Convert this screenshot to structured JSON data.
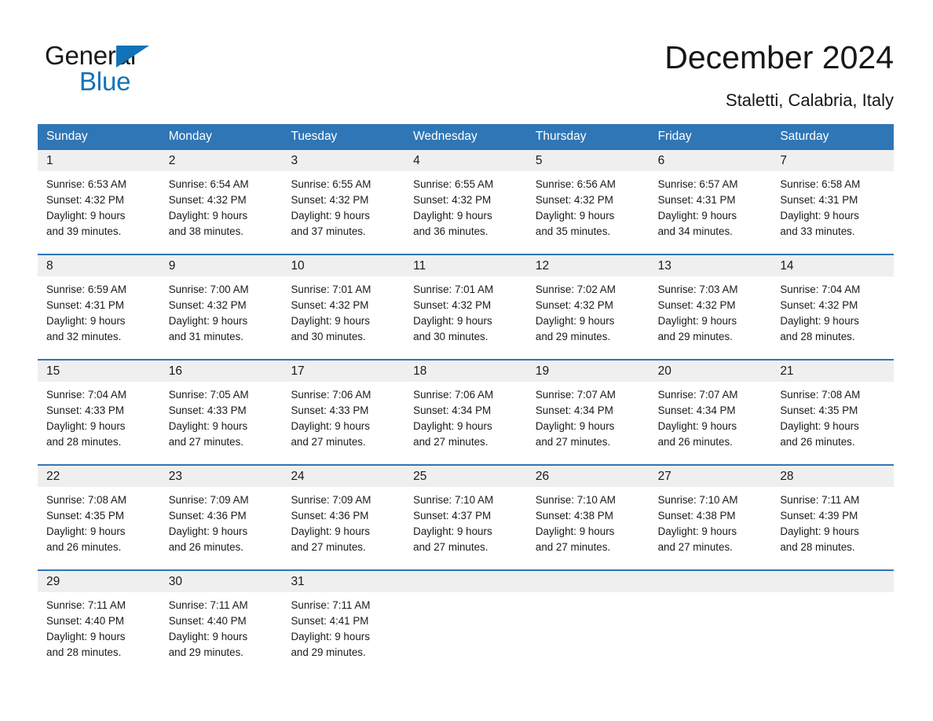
{
  "brand": {
    "name_part1": "General",
    "name_part2": "Blue",
    "triangle_color": "#1273b8"
  },
  "header": {
    "title": "December 2024",
    "subtitle": "Staletti, Calabria, Italy"
  },
  "colors": {
    "header_blue": "#2f76b6",
    "daynum_gray": "#efefef",
    "text": "#1a1a1a"
  },
  "weekdays": [
    "Sunday",
    "Monday",
    "Tuesday",
    "Wednesday",
    "Thursday",
    "Friday",
    "Saturday"
  ],
  "weeks": [
    [
      {
        "day": "1",
        "sunrise": "Sunrise: 6:53 AM",
        "sunset": "Sunset: 4:32 PM",
        "daylight1": "Daylight: 9 hours",
        "daylight2": "and 39 minutes."
      },
      {
        "day": "2",
        "sunrise": "Sunrise: 6:54 AM",
        "sunset": "Sunset: 4:32 PM",
        "daylight1": "Daylight: 9 hours",
        "daylight2": "and 38 minutes."
      },
      {
        "day": "3",
        "sunrise": "Sunrise: 6:55 AM",
        "sunset": "Sunset: 4:32 PM",
        "daylight1": "Daylight: 9 hours",
        "daylight2": "and 37 minutes."
      },
      {
        "day": "4",
        "sunrise": "Sunrise: 6:55 AM",
        "sunset": "Sunset: 4:32 PM",
        "daylight1": "Daylight: 9 hours",
        "daylight2": "and 36 minutes."
      },
      {
        "day": "5",
        "sunrise": "Sunrise: 6:56 AM",
        "sunset": "Sunset: 4:32 PM",
        "daylight1": "Daylight: 9 hours",
        "daylight2": "and 35 minutes."
      },
      {
        "day": "6",
        "sunrise": "Sunrise: 6:57 AM",
        "sunset": "Sunset: 4:31 PM",
        "daylight1": "Daylight: 9 hours",
        "daylight2": "and 34 minutes."
      },
      {
        "day": "7",
        "sunrise": "Sunrise: 6:58 AM",
        "sunset": "Sunset: 4:31 PM",
        "daylight1": "Daylight: 9 hours",
        "daylight2": "and 33 minutes."
      }
    ],
    [
      {
        "day": "8",
        "sunrise": "Sunrise: 6:59 AM",
        "sunset": "Sunset: 4:31 PM",
        "daylight1": "Daylight: 9 hours",
        "daylight2": "and 32 minutes."
      },
      {
        "day": "9",
        "sunrise": "Sunrise: 7:00 AM",
        "sunset": "Sunset: 4:32 PM",
        "daylight1": "Daylight: 9 hours",
        "daylight2": "and 31 minutes."
      },
      {
        "day": "10",
        "sunrise": "Sunrise: 7:01 AM",
        "sunset": "Sunset: 4:32 PM",
        "daylight1": "Daylight: 9 hours",
        "daylight2": "and 30 minutes."
      },
      {
        "day": "11",
        "sunrise": "Sunrise: 7:01 AM",
        "sunset": "Sunset: 4:32 PM",
        "daylight1": "Daylight: 9 hours",
        "daylight2": "and 30 minutes."
      },
      {
        "day": "12",
        "sunrise": "Sunrise: 7:02 AM",
        "sunset": "Sunset: 4:32 PM",
        "daylight1": "Daylight: 9 hours",
        "daylight2": "and 29 minutes."
      },
      {
        "day": "13",
        "sunrise": "Sunrise: 7:03 AM",
        "sunset": "Sunset: 4:32 PM",
        "daylight1": "Daylight: 9 hours",
        "daylight2": "and 29 minutes."
      },
      {
        "day": "14",
        "sunrise": "Sunrise: 7:04 AM",
        "sunset": "Sunset: 4:32 PM",
        "daylight1": "Daylight: 9 hours",
        "daylight2": "and 28 minutes."
      }
    ],
    [
      {
        "day": "15",
        "sunrise": "Sunrise: 7:04 AM",
        "sunset": "Sunset: 4:33 PM",
        "daylight1": "Daylight: 9 hours",
        "daylight2": "and 28 minutes."
      },
      {
        "day": "16",
        "sunrise": "Sunrise: 7:05 AM",
        "sunset": "Sunset: 4:33 PM",
        "daylight1": "Daylight: 9 hours",
        "daylight2": "and 27 minutes."
      },
      {
        "day": "17",
        "sunrise": "Sunrise: 7:06 AM",
        "sunset": "Sunset: 4:33 PM",
        "daylight1": "Daylight: 9 hours",
        "daylight2": "and 27 minutes."
      },
      {
        "day": "18",
        "sunrise": "Sunrise: 7:06 AM",
        "sunset": "Sunset: 4:34 PM",
        "daylight1": "Daylight: 9 hours",
        "daylight2": "and 27 minutes."
      },
      {
        "day": "19",
        "sunrise": "Sunrise: 7:07 AM",
        "sunset": "Sunset: 4:34 PM",
        "daylight1": "Daylight: 9 hours",
        "daylight2": "and 27 minutes."
      },
      {
        "day": "20",
        "sunrise": "Sunrise: 7:07 AM",
        "sunset": "Sunset: 4:34 PM",
        "daylight1": "Daylight: 9 hours",
        "daylight2": "and 26 minutes."
      },
      {
        "day": "21",
        "sunrise": "Sunrise: 7:08 AM",
        "sunset": "Sunset: 4:35 PM",
        "daylight1": "Daylight: 9 hours",
        "daylight2": "and 26 minutes."
      }
    ],
    [
      {
        "day": "22",
        "sunrise": "Sunrise: 7:08 AM",
        "sunset": "Sunset: 4:35 PM",
        "daylight1": "Daylight: 9 hours",
        "daylight2": "and 26 minutes."
      },
      {
        "day": "23",
        "sunrise": "Sunrise: 7:09 AM",
        "sunset": "Sunset: 4:36 PM",
        "daylight1": "Daylight: 9 hours",
        "daylight2": "and 26 minutes."
      },
      {
        "day": "24",
        "sunrise": "Sunrise: 7:09 AM",
        "sunset": "Sunset: 4:36 PM",
        "daylight1": "Daylight: 9 hours",
        "daylight2": "and 27 minutes."
      },
      {
        "day": "25",
        "sunrise": "Sunrise: 7:10 AM",
        "sunset": "Sunset: 4:37 PM",
        "daylight1": "Daylight: 9 hours",
        "daylight2": "and 27 minutes."
      },
      {
        "day": "26",
        "sunrise": "Sunrise: 7:10 AM",
        "sunset": "Sunset: 4:38 PM",
        "daylight1": "Daylight: 9 hours",
        "daylight2": "and 27 minutes."
      },
      {
        "day": "27",
        "sunrise": "Sunrise: 7:10 AM",
        "sunset": "Sunset: 4:38 PM",
        "daylight1": "Daylight: 9 hours",
        "daylight2": "and 27 minutes."
      },
      {
        "day": "28",
        "sunrise": "Sunrise: 7:11 AM",
        "sunset": "Sunset: 4:39 PM",
        "daylight1": "Daylight: 9 hours",
        "daylight2": "and 28 minutes."
      }
    ],
    [
      {
        "day": "29",
        "sunrise": "Sunrise: 7:11 AM",
        "sunset": "Sunset: 4:40 PM",
        "daylight1": "Daylight: 9 hours",
        "daylight2": "and 28 minutes."
      },
      {
        "day": "30",
        "sunrise": "Sunrise: 7:11 AM",
        "sunset": "Sunset: 4:40 PM",
        "daylight1": "Daylight: 9 hours",
        "daylight2": "and 29 minutes."
      },
      {
        "day": "31",
        "sunrise": "Sunrise: 7:11 AM",
        "sunset": "Sunset: 4:41 PM",
        "daylight1": "Daylight: 9 hours",
        "daylight2": "and 29 minutes."
      },
      {
        "day": "",
        "sunrise": "",
        "sunset": "",
        "daylight1": "",
        "daylight2": ""
      },
      {
        "day": "",
        "sunrise": "",
        "sunset": "",
        "daylight1": "",
        "daylight2": ""
      },
      {
        "day": "",
        "sunrise": "",
        "sunset": "",
        "daylight1": "",
        "daylight2": ""
      },
      {
        "day": "",
        "sunrise": "",
        "sunset": "",
        "daylight1": "",
        "daylight2": ""
      }
    ]
  ]
}
